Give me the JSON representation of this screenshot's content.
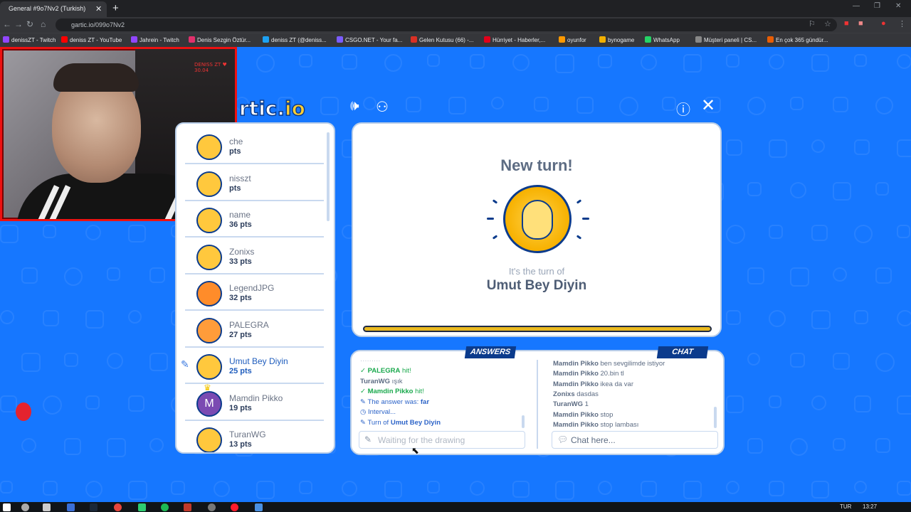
{
  "browser": {
    "tab_title": "General #9o7Nv2 (Turkish)",
    "tab_close": "✕",
    "new_tab": "+",
    "url": "gartic.io/099o7Nv2",
    "bookmarks": [
      {
        "label": "denissZT - Twitch",
        "color": "#9146ff"
      },
      {
        "label": "deniss ZT - YouTube",
        "color": "#ff0000"
      },
      {
        "label": "Jahrein - Twitch",
        "color": "#9146ff"
      },
      {
        "label": "Denis Sezgin Öztür...",
        "color": "#e1306c"
      },
      {
        "label": "deniss ZT (@deniss...",
        "color": "#1da1f2"
      },
      {
        "label": "CSGO.NET - Your fa...",
        "color": "#7b5cff"
      },
      {
        "label": "Gelen Kutusu (66) -...",
        "color": "#d93025"
      },
      {
        "label": "Hürriyet - Haberler,...",
        "color": "#e2001a"
      },
      {
        "label": "oyunfor",
        "color": "#ff9900"
      },
      {
        "label": "bynogame",
        "color": "#f2b000"
      },
      {
        "label": "WhatsApp",
        "color": "#25d366"
      },
      {
        "label": "Müşteri paneli | CS...",
        "color": "#888888"
      },
      {
        "label": "En çok 365 gündür...",
        "color": "#e85d04"
      }
    ]
  },
  "webcam": {
    "label": "DENISS ZT ♥ 30.04"
  },
  "game": {
    "logo_left": "rtic.",
    "logo_right": "io"
  },
  "players": [
    {
      "name": "che",
      "pts": "pts",
      "avatar_color": "#ffc83d"
    },
    {
      "name": "nisszt",
      "pts": "pts",
      "avatar_color": "#ffc83d"
    },
    {
      "name": "name",
      "pts": "36 pts",
      "avatar_color": "#ffc83d"
    },
    {
      "name": "Zonixs",
      "pts": "33 pts",
      "avatar_color": "#ffc83d"
    },
    {
      "name": "LegendJPG",
      "pts": "32 pts",
      "avatar_color": "#ff8c2a"
    },
    {
      "name": "PALEGRA",
      "pts": "27 pts",
      "avatar_color": "#ff9c3a"
    },
    {
      "name": "Umut Bey Diyin",
      "pts": "25 pts",
      "avatar_color": "#ffc83d"
    },
    {
      "name": "Mamdin Pikko",
      "pts": "19 pts",
      "avatar_color": "#7b4ab2",
      "initial": "M"
    },
    {
      "name": "TuranWG",
      "pts": "13 pts",
      "avatar_color": "#ffc83d"
    }
  ],
  "turn": {
    "title": "New turn!",
    "subtitle": "It's the turn of",
    "player": "Umut Bey Diyin",
    "progress": 1.0
  },
  "answers": {
    "label": "ANSWERS",
    "lines": [
      {
        "pre": "",
        "who": "PALEGRA",
        "text": " hit!",
        "style": "green"
      },
      {
        "pre": "",
        "who": "TuranWG",
        "text": " ışık",
        "style": "plain"
      },
      {
        "pre": "",
        "who": "Mamdin Pikko",
        "text": " hit!",
        "style": "green"
      },
      {
        "pre": "The answer was: ",
        "who": "far",
        "text": "",
        "style": "blue"
      },
      {
        "pre": "Interval...",
        "who": "",
        "text": "",
        "style": "blue"
      },
      {
        "pre": "Turn of ",
        "who": "Umut Bey Diyin",
        "text": "",
        "style": "blue"
      }
    ],
    "placeholder": "Waiting for the drawing"
  },
  "chat": {
    "label": "CHAT",
    "lines": [
      {
        "who": "Mamdin Pikko",
        "text": " ben sevgilimde istiyor"
      },
      {
        "who": "Mamdin Pikko",
        "text": " 20.bin tl"
      },
      {
        "who": "Mamdin Pikko",
        "text": " ikea da var"
      },
      {
        "who": "Zonixs",
        "text": " dasdas"
      },
      {
        "who": "TuranWG",
        "text": " 1"
      },
      {
        "who": "Mamdin Pikko",
        "text": " stop"
      },
      {
        "who": "Mamdin Pikko",
        "text": " stop lambası"
      }
    ],
    "placeholder": "Chat here..."
  },
  "taskbar": {
    "lang": "TUR",
    "time": "13:27"
  }
}
